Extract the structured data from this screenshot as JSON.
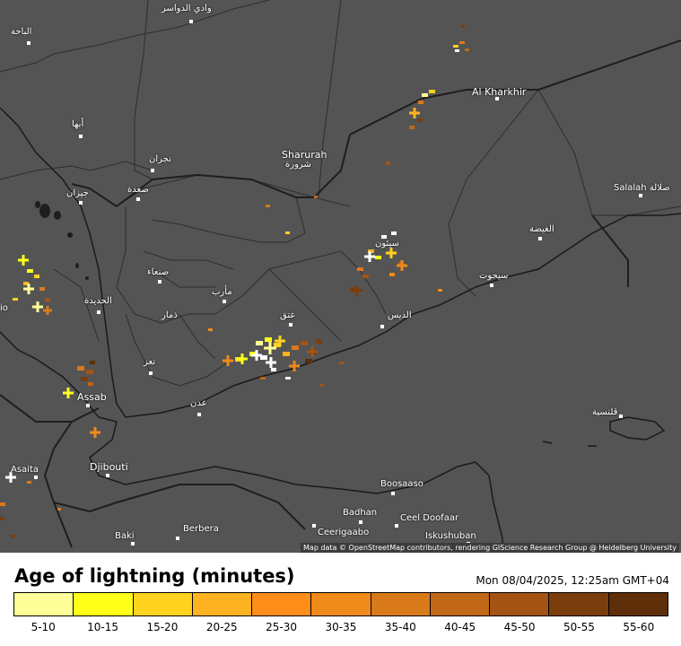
{
  "map": {
    "attribution": "Map data © OpenStreetMap contributors, rendering GIScience Research Group @ Heidelberg University",
    "places": [
      {
        "id": "wadi-ad-dawasir",
        "text": "وادي الدواسر"
      },
      {
        "id": "al-baha",
        "text": "الباحة"
      },
      {
        "id": "abha",
        "text": "أبها"
      },
      {
        "id": "najran",
        "text": "نجران"
      },
      {
        "id": "jizan",
        "text": "جيزان"
      },
      {
        "id": "saada",
        "text": "صعدة"
      },
      {
        "id": "sharurah-en",
        "text": "Sharurah"
      },
      {
        "id": "sharurah-ar",
        "text": "شرورة"
      },
      {
        "id": "al-kharkhir",
        "text": "Al Kharkhir"
      },
      {
        "id": "salalah",
        "text": "Salalah صلالة"
      },
      {
        "id": "al-ghaydah",
        "text": "الغيضة"
      },
      {
        "id": "sayhut",
        "text": "سيحوت"
      },
      {
        "id": "seiyun",
        "text": "سيئون"
      },
      {
        "id": "sanaa",
        "text": "صنعاء"
      },
      {
        "id": "marib",
        "text": "مأرب"
      },
      {
        "id": "hodeidah",
        "text": "الحديدة"
      },
      {
        "id": "dhamar",
        "text": "ذمار"
      },
      {
        "id": "ataq",
        "text": "عتق"
      },
      {
        "id": "al-mukalla",
        "text": "الديس"
      },
      {
        "id": "taiz",
        "text": "تعز"
      },
      {
        "id": "aden",
        "text": "عدن"
      },
      {
        "id": "assab",
        "text": "Assab"
      },
      {
        "id": "massawa",
        "text": "io"
      },
      {
        "id": "djibouti",
        "text": "Djibouti"
      },
      {
        "id": "asaita",
        "text": "Asaita"
      },
      {
        "id": "socotra",
        "text": "قلنسية"
      },
      {
        "id": "boosaaso",
        "text": "Boosaaso"
      },
      {
        "id": "badhan",
        "text": "Badhan"
      },
      {
        "id": "ceel-doofaar",
        "text": "Ceel Doofaar"
      },
      {
        "id": "ceerigaabo",
        "text": "Ceerigaabo"
      },
      {
        "id": "iskushuban",
        "text": "Iskushuban"
      },
      {
        "id": "berbera",
        "text": "Berbera"
      },
      {
        "id": "baki",
        "text": "Baki"
      }
    ]
  },
  "legend": {
    "title": "Age of lightning (minutes)",
    "timestamp": "Mon 08/04/2025, 12:25am GMT+04",
    "bins": [
      {
        "label": "5-10",
        "color": "#ffff99"
      },
      {
        "label": "10-15",
        "color": "#ffff1a"
      },
      {
        "label": "15-20",
        "color": "#ffd21f"
      },
      {
        "label": "20-25",
        "color": "#ffb21f"
      },
      {
        "label": "25-30",
        "color": "#ff8d1a"
      },
      {
        "label": "30-35",
        "color": "#f08a1a"
      },
      {
        "label": "35-40",
        "color": "#d97a1a"
      },
      {
        "label": "40-45",
        "color": "#c06818"
      },
      {
        "label": "45-50",
        "color": "#a35414"
      },
      {
        "label": "50-55",
        "color": "#7a3d0d"
      },
      {
        "label": "55-60",
        "color": "#5e2e08"
      }
    ]
  },
  "colors": {
    "fresh": "#ffffff",
    "sea_land": "#545454",
    "border": "#2a2a2a"
  }
}
